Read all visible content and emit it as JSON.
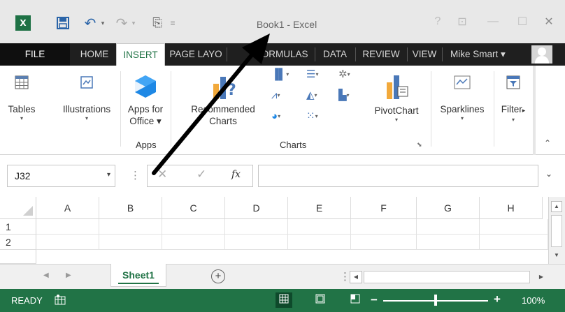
{
  "window": {
    "title": "Book1 - Excel",
    "excel_icon_text": "X",
    "help": "?",
    "ribbon_display": "⊡",
    "minimize": "—",
    "maximize": "☐",
    "close": "✕"
  },
  "qat": {
    "undo": "↶",
    "redo": "↷",
    "dropdown": "▾",
    "preview": "⎘",
    "more": "="
  },
  "tabs": {
    "file": "FILE",
    "home": "HOME",
    "insert": "INSERT",
    "page_layout": "PAGE LAYO",
    "formulas": "FORMULAS",
    "data": "DATA",
    "review": "REVIEW",
    "view": "VIEW",
    "active": "INSERT"
  },
  "user": {
    "name": "Mike Smart ▾"
  },
  "ribbon": {
    "tables": "Tables",
    "illustrations": "Illustrations",
    "apps_for_office_1": "Apps for",
    "apps_for_office_2": "Office ▾",
    "apps_group": "Apps",
    "recommended_charts_1": "Recommended",
    "recommended_charts_2": "Charts",
    "pivot_chart": "PivotChart",
    "charts_group": "Charts",
    "sparklines": "Sparklines",
    "filters": "Filter",
    "caret": "▾",
    "more": "▸",
    "collapse": "⌃",
    "launcher": "⬊"
  },
  "formula_bar": {
    "name_box_value": "J32",
    "dropdown": "▾",
    "dots": "⋮",
    "cancel": "✕",
    "enter": "✓",
    "fx": "fx",
    "value": "",
    "expand": "⌄"
  },
  "grid": {
    "columns": [
      "A",
      "B",
      "C",
      "D",
      "E",
      "F",
      "G",
      "H"
    ],
    "rows": [
      "1",
      "2"
    ],
    "scroll_up": "▲",
    "scroll_down": "▼"
  },
  "sheets": {
    "prev": "◀",
    "next": "▶",
    "tabs": [
      "Sheet1"
    ],
    "add": "+",
    "dots": "⋮",
    "scroll_left": "◀",
    "scroll_right": "▶"
  },
  "status": {
    "text": "READY",
    "zoom_minus": "−",
    "zoom_plus": "+",
    "zoom": "100%",
    "zoom_level": 0.5
  },
  "colors": {
    "accent": "#217346",
    "tab_bar": "#1f1f1f",
    "title_bar": "#e8e8e8"
  }
}
